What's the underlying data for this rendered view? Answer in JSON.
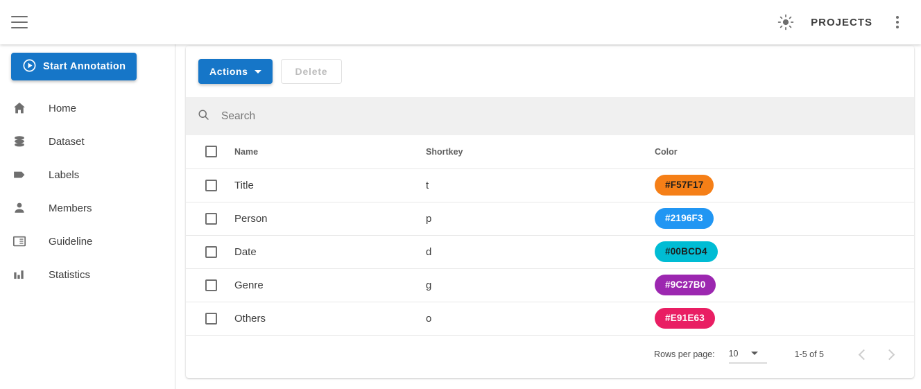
{
  "appbar": {
    "menu_icon": "hamburger-menu-icon",
    "brightness_icon": "sun-brightness-icon",
    "projects_label": "PROJECTS",
    "overflow_icon": "more-vert-icon"
  },
  "sidebar": {
    "start_button": {
      "label": "Start Annotation",
      "icon": "play-circle-icon",
      "color": "#1676c8"
    },
    "items": [
      {
        "label": "Home",
        "icon": "home-icon"
      },
      {
        "label": "Dataset",
        "icon": "database-icon"
      },
      {
        "label": "Labels",
        "icon": "tag-icon"
      },
      {
        "label": "Members",
        "icon": "person-icon"
      },
      {
        "label": "Guideline",
        "icon": "book-panels-icon"
      },
      {
        "label": "Statistics",
        "icon": "bar-chart-icon"
      }
    ]
  },
  "toolbar": {
    "actions_label": "Actions",
    "actions_caret": "caret-down-icon",
    "delete_label": "Delete",
    "delete_disabled": true
  },
  "search": {
    "icon": "search-icon",
    "placeholder": "Search",
    "value": ""
  },
  "table": {
    "columns": [
      "",
      "Name",
      "Shortkey",
      "Color"
    ],
    "select_all_checked": false,
    "rows": [
      {
        "checked": false,
        "name": "Title",
        "shortkey": "t",
        "color": "#F57F17",
        "text_color": "#1c1c1c"
      },
      {
        "checked": false,
        "name": "Person",
        "shortkey": "p",
        "color": "#2196F3",
        "text_color": "#ffffff"
      },
      {
        "checked": false,
        "name": "Date",
        "shortkey": "d",
        "color": "#00BCD4",
        "text_color": "#1c1c1c"
      },
      {
        "checked": false,
        "name": "Genre",
        "shortkey": "g",
        "color": "#9C27B0",
        "text_color": "#ffffff"
      },
      {
        "checked": false,
        "name": "Others",
        "shortkey": "o",
        "color": "#E91E63",
        "text_color": "#ffffff"
      }
    ]
  },
  "paginator": {
    "rows_per_page_label": "Rows per page:",
    "rows_per_page_value": "10",
    "caret_icon": "caret-down-icon",
    "range_label": "1-5 of 5",
    "prev_icon": "chevron-left-icon",
    "next_icon": "chevron-right-icon",
    "prev_disabled": true,
    "next_disabled": true
  }
}
